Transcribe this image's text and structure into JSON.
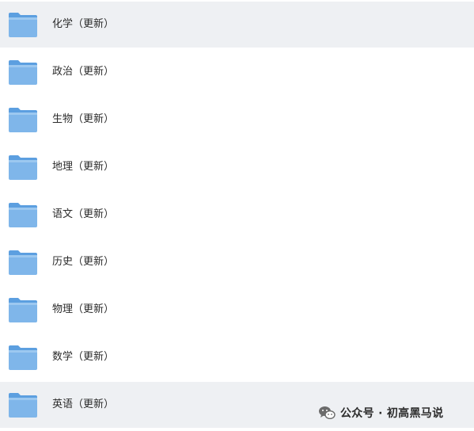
{
  "folders": [
    {
      "label": "化学（更新）",
      "icon": "folder-icon"
    },
    {
      "label": "政治（更新）",
      "icon": "folder-icon"
    },
    {
      "label": "生物（更新）",
      "icon": "folder-icon"
    },
    {
      "label": "地理（更新）",
      "icon": "folder-icon"
    },
    {
      "label": "语文（更新）",
      "icon": "folder-icon"
    },
    {
      "label": "历史（更新）",
      "icon": "folder-icon"
    },
    {
      "label": "物理（更新）",
      "icon": "folder-icon"
    },
    {
      "label": "数学（更新）",
      "icon": "folder-icon"
    },
    {
      "label": "英语（更新）",
      "icon": "folder-icon"
    }
  ],
  "watermark": {
    "text": "公众号 · 初高黑马说",
    "icon": "wechat-icon"
  },
  "colors": {
    "row_highlight": "#eef0f3",
    "folder_body": "#7fb6ea",
    "folder_tab": "#5c9fe0",
    "text": "#2b2b2b"
  }
}
